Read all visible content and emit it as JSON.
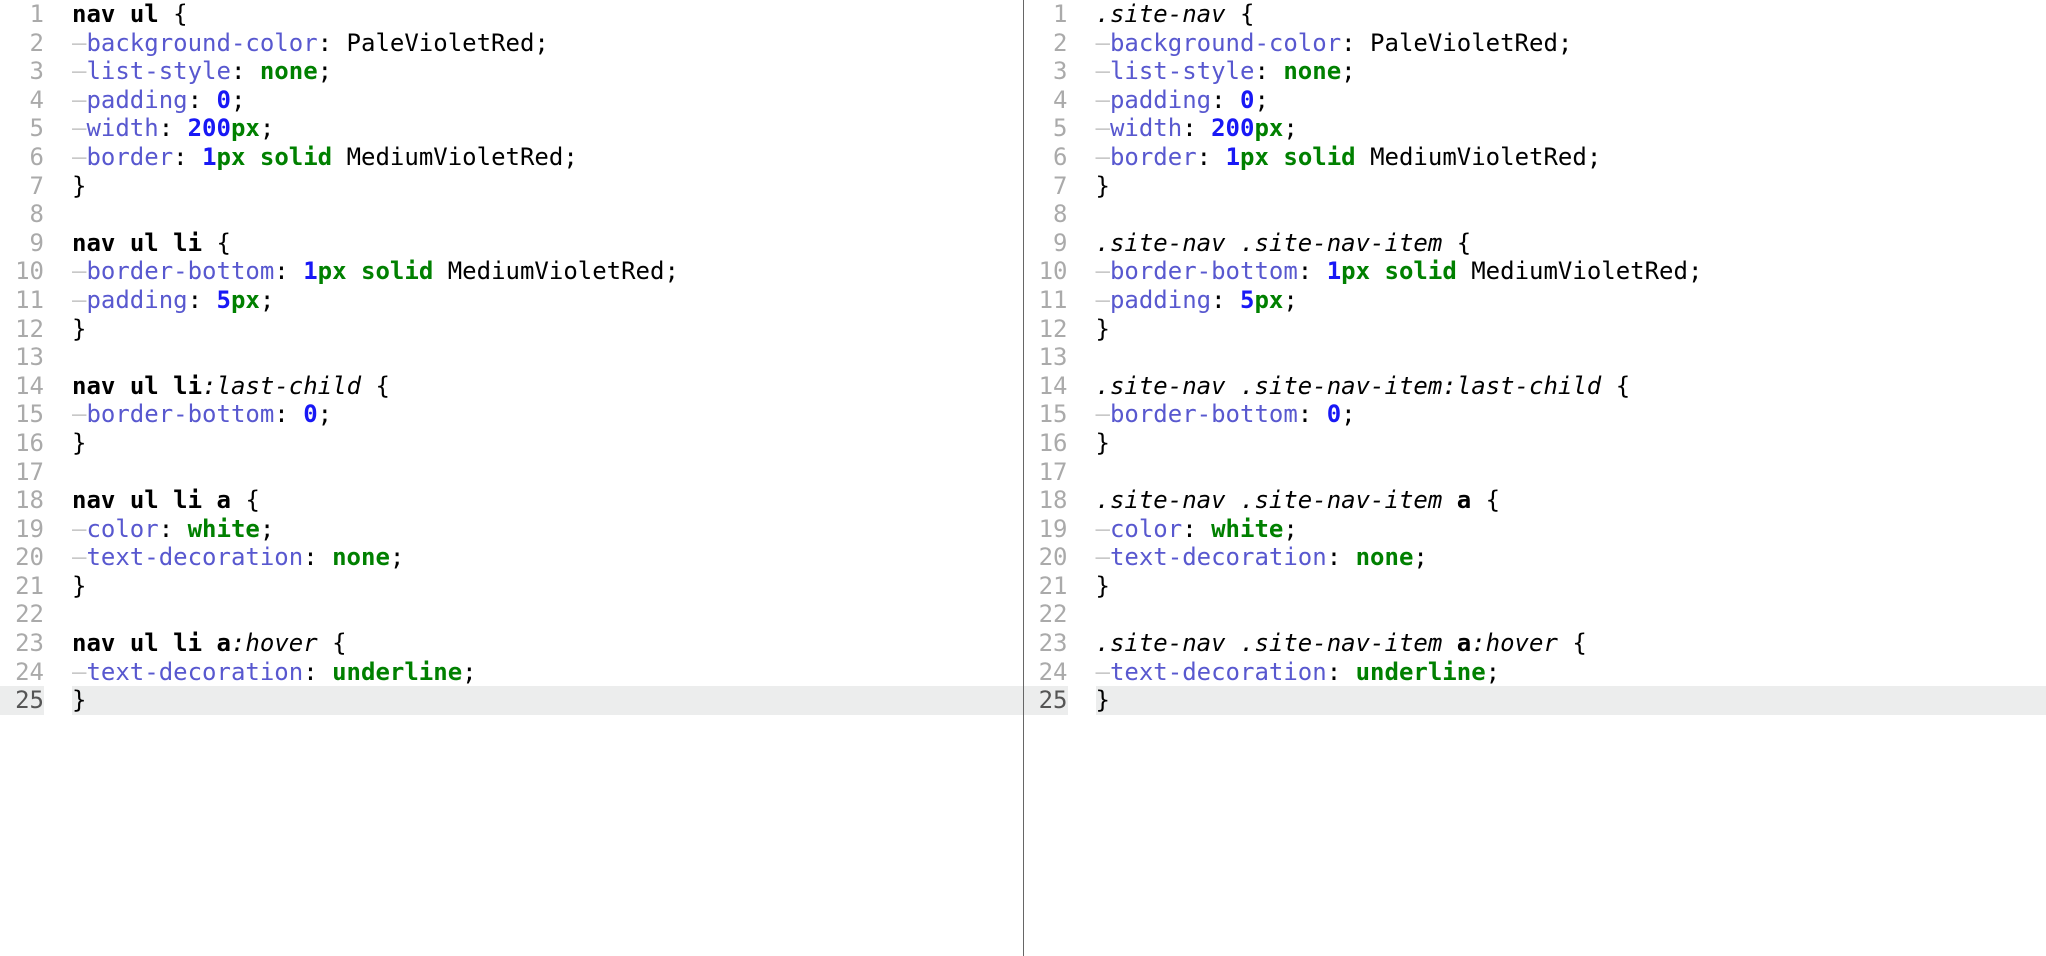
{
  "panes": [
    {
      "side": "left",
      "totalLines": 25,
      "currentLine": 25,
      "lines": [
        {
          "indent": 0,
          "tokens": [
            [
              "tag",
              "nav"
            ],
            [
              "text",
              " "
            ],
            [
              "tag",
              "ul"
            ],
            [
              "text",
              " "
            ],
            [
              "punc",
              "{"
            ]
          ]
        },
        {
          "indent": 1,
          "tokens": [
            [
              "prop",
              "background-color"
            ],
            [
              "punc",
              ":"
            ],
            [
              "text",
              " "
            ],
            [
              "plain",
              "PaleVioletRed"
            ],
            [
              "punc",
              ";"
            ]
          ]
        },
        {
          "indent": 1,
          "tokens": [
            [
              "prop",
              "list-style"
            ],
            [
              "punc",
              ":"
            ],
            [
              "text",
              " "
            ],
            [
              "kw",
              "none"
            ],
            [
              "punc",
              ";"
            ]
          ]
        },
        {
          "indent": 1,
          "tokens": [
            [
              "prop",
              "padding"
            ],
            [
              "punc",
              ":"
            ],
            [
              "text",
              " "
            ],
            [
              "num",
              "0"
            ],
            [
              "punc",
              ";"
            ]
          ]
        },
        {
          "indent": 1,
          "tokens": [
            [
              "prop",
              "width"
            ],
            [
              "punc",
              ":"
            ],
            [
              "text",
              " "
            ],
            [
              "num",
              "200"
            ],
            [
              "unit",
              "px"
            ],
            [
              "punc",
              ";"
            ]
          ]
        },
        {
          "indent": 1,
          "tokens": [
            [
              "prop",
              "border"
            ],
            [
              "punc",
              ":"
            ],
            [
              "text",
              " "
            ],
            [
              "num",
              "1"
            ],
            [
              "unit",
              "px"
            ],
            [
              "text",
              " "
            ],
            [
              "kw",
              "solid"
            ],
            [
              "text",
              " "
            ],
            [
              "plain",
              "MediumVioletRed"
            ],
            [
              "punc",
              ";"
            ]
          ]
        },
        {
          "indent": 0,
          "tokens": [
            [
              "punc",
              "}"
            ]
          ]
        },
        {
          "indent": 0,
          "tokens": []
        },
        {
          "indent": 0,
          "tokens": [
            [
              "tag",
              "nav"
            ],
            [
              "text",
              " "
            ],
            [
              "tag",
              "ul"
            ],
            [
              "text",
              " "
            ],
            [
              "tag",
              "li"
            ],
            [
              "text",
              " "
            ],
            [
              "punc",
              "{"
            ]
          ]
        },
        {
          "indent": 1,
          "tokens": [
            [
              "prop",
              "border-bottom"
            ],
            [
              "punc",
              ":"
            ],
            [
              "text",
              " "
            ],
            [
              "num",
              "1"
            ],
            [
              "unit",
              "px"
            ],
            [
              "text",
              " "
            ],
            [
              "kw",
              "solid"
            ],
            [
              "text",
              " "
            ],
            [
              "plain",
              "MediumVioletRed"
            ],
            [
              "punc",
              ";"
            ]
          ]
        },
        {
          "indent": 1,
          "tokens": [
            [
              "prop",
              "padding"
            ],
            [
              "punc",
              ":"
            ],
            [
              "text",
              " "
            ],
            [
              "num",
              "5"
            ],
            [
              "unit",
              "px"
            ],
            [
              "punc",
              ";"
            ]
          ]
        },
        {
          "indent": 0,
          "tokens": [
            [
              "punc",
              "}"
            ]
          ]
        },
        {
          "indent": 0,
          "tokens": []
        },
        {
          "indent": 0,
          "tokens": [
            [
              "tag",
              "nav"
            ],
            [
              "text",
              " "
            ],
            [
              "tag",
              "ul"
            ],
            [
              "text",
              " "
            ],
            [
              "tag",
              "li"
            ],
            [
              "pseudo",
              ":last-child"
            ],
            [
              "text",
              " "
            ],
            [
              "punc",
              "{"
            ]
          ]
        },
        {
          "indent": 1,
          "tokens": [
            [
              "prop",
              "border-bottom"
            ],
            [
              "punc",
              ":"
            ],
            [
              "text",
              " "
            ],
            [
              "num",
              "0"
            ],
            [
              "punc",
              ";"
            ]
          ]
        },
        {
          "indent": 0,
          "tokens": [
            [
              "punc",
              "}"
            ]
          ]
        },
        {
          "indent": 0,
          "tokens": []
        },
        {
          "indent": 0,
          "tokens": [
            [
              "tag",
              "nav"
            ],
            [
              "text",
              " "
            ],
            [
              "tag",
              "ul"
            ],
            [
              "text",
              " "
            ],
            [
              "tag",
              "li"
            ],
            [
              "text",
              " "
            ],
            [
              "tag",
              "a"
            ],
            [
              "text",
              " "
            ],
            [
              "punc",
              "{"
            ]
          ]
        },
        {
          "indent": 1,
          "tokens": [
            [
              "prop",
              "color"
            ],
            [
              "punc",
              ":"
            ],
            [
              "text",
              " "
            ],
            [
              "kw",
              "white"
            ],
            [
              "punc",
              ";"
            ]
          ]
        },
        {
          "indent": 1,
          "tokens": [
            [
              "prop",
              "text-decoration"
            ],
            [
              "punc",
              ":"
            ],
            [
              "text",
              " "
            ],
            [
              "kw",
              "none"
            ],
            [
              "punc",
              ";"
            ]
          ]
        },
        {
          "indent": 0,
          "tokens": [
            [
              "punc",
              "}"
            ]
          ]
        },
        {
          "indent": 0,
          "tokens": []
        },
        {
          "indent": 0,
          "tokens": [
            [
              "tag",
              "nav"
            ],
            [
              "text",
              " "
            ],
            [
              "tag",
              "ul"
            ],
            [
              "text",
              " "
            ],
            [
              "tag",
              "li"
            ],
            [
              "text",
              " "
            ],
            [
              "tag",
              "a"
            ],
            [
              "pseudo",
              ":hover"
            ],
            [
              "text",
              " "
            ],
            [
              "punc",
              "{"
            ]
          ]
        },
        {
          "indent": 1,
          "tokens": [
            [
              "prop",
              "text-decoration"
            ],
            [
              "punc",
              ":"
            ],
            [
              "text",
              " "
            ],
            [
              "kw",
              "underline"
            ],
            [
              "punc",
              ";"
            ]
          ]
        },
        {
          "indent": 0,
          "tokens": [
            [
              "punc",
              "}"
            ]
          ]
        }
      ]
    },
    {
      "side": "right",
      "totalLines": 25,
      "currentLine": 25,
      "lines": [
        {
          "indent": 0,
          "tokens": [
            [
              "class",
              ".site-nav"
            ],
            [
              "text",
              " "
            ],
            [
              "punc",
              "{"
            ]
          ]
        },
        {
          "indent": 1,
          "tokens": [
            [
              "prop",
              "background-color"
            ],
            [
              "punc",
              ":"
            ],
            [
              "text",
              " "
            ],
            [
              "plain",
              "PaleVioletRed"
            ],
            [
              "punc",
              ";"
            ]
          ]
        },
        {
          "indent": 1,
          "tokens": [
            [
              "prop",
              "list-style"
            ],
            [
              "punc",
              ":"
            ],
            [
              "text",
              " "
            ],
            [
              "kw",
              "none"
            ],
            [
              "punc",
              ";"
            ]
          ]
        },
        {
          "indent": 1,
          "tokens": [
            [
              "prop",
              "padding"
            ],
            [
              "punc",
              ":"
            ],
            [
              "text",
              " "
            ],
            [
              "num",
              "0"
            ],
            [
              "punc",
              ";"
            ]
          ]
        },
        {
          "indent": 1,
          "tokens": [
            [
              "prop",
              "width"
            ],
            [
              "punc",
              ":"
            ],
            [
              "text",
              " "
            ],
            [
              "num",
              "200"
            ],
            [
              "unit",
              "px"
            ],
            [
              "punc",
              ";"
            ]
          ]
        },
        {
          "indent": 1,
          "tokens": [
            [
              "prop",
              "border"
            ],
            [
              "punc",
              ":"
            ],
            [
              "text",
              " "
            ],
            [
              "num",
              "1"
            ],
            [
              "unit",
              "px"
            ],
            [
              "text",
              " "
            ],
            [
              "kw",
              "solid"
            ],
            [
              "text",
              " "
            ],
            [
              "plain",
              "MediumVioletRed"
            ],
            [
              "punc",
              ";"
            ]
          ]
        },
        {
          "indent": 0,
          "tokens": [
            [
              "punc",
              "}"
            ]
          ]
        },
        {
          "indent": 0,
          "tokens": []
        },
        {
          "indent": 0,
          "tokens": [
            [
              "class",
              ".site-nav"
            ],
            [
              "text",
              " "
            ],
            [
              "class",
              ".site-nav-item"
            ],
            [
              "text",
              " "
            ],
            [
              "punc",
              "{"
            ]
          ]
        },
        {
          "indent": 1,
          "tokens": [
            [
              "prop",
              "border-bottom"
            ],
            [
              "punc",
              ":"
            ],
            [
              "text",
              " "
            ],
            [
              "num",
              "1"
            ],
            [
              "unit",
              "px"
            ],
            [
              "text",
              " "
            ],
            [
              "kw",
              "solid"
            ],
            [
              "text",
              " "
            ],
            [
              "plain",
              "MediumVioletRed"
            ],
            [
              "punc",
              ";"
            ]
          ]
        },
        {
          "indent": 1,
          "tokens": [
            [
              "prop",
              "padding"
            ],
            [
              "punc",
              ":"
            ],
            [
              "text",
              " "
            ],
            [
              "num",
              "5"
            ],
            [
              "unit",
              "px"
            ],
            [
              "punc",
              ";"
            ]
          ]
        },
        {
          "indent": 0,
          "tokens": [
            [
              "punc",
              "}"
            ]
          ]
        },
        {
          "indent": 0,
          "tokens": []
        },
        {
          "indent": 0,
          "tokens": [
            [
              "class",
              ".site-nav"
            ],
            [
              "text",
              " "
            ],
            [
              "class",
              ".site-nav-item"
            ],
            [
              "pseudo",
              ":last-child"
            ],
            [
              "text",
              " "
            ],
            [
              "punc",
              "{"
            ]
          ]
        },
        {
          "indent": 1,
          "tokens": [
            [
              "prop",
              "border-bottom"
            ],
            [
              "punc",
              ":"
            ],
            [
              "text",
              " "
            ],
            [
              "num",
              "0"
            ],
            [
              "punc",
              ";"
            ]
          ]
        },
        {
          "indent": 0,
          "tokens": [
            [
              "punc",
              "}"
            ]
          ]
        },
        {
          "indent": 0,
          "tokens": []
        },
        {
          "indent": 0,
          "tokens": [
            [
              "class",
              ".site-nav"
            ],
            [
              "text",
              " "
            ],
            [
              "class",
              ".site-nav-item"
            ],
            [
              "text",
              " "
            ],
            [
              "tag",
              "a"
            ],
            [
              "text",
              " "
            ],
            [
              "punc",
              "{"
            ]
          ]
        },
        {
          "indent": 1,
          "tokens": [
            [
              "prop",
              "color"
            ],
            [
              "punc",
              ":"
            ],
            [
              "text",
              " "
            ],
            [
              "kw",
              "white"
            ],
            [
              "punc",
              ";"
            ]
          ]
        },
        {
          "indent": 1,
          "tokens": [
            [
              "prop",
              "text-decoration"
            ],
            [
              "punc",
              ":"
            ],
            [
              "text",
              " "
            ],
            [
              "kw",
              "none"
            ],
            [
              "punc",
              ";"
            ]
          ]
        },
        {
          "indent": 0,
          "tokens": [
            [
              "punc",
              "}"
            ]
          ]
        },
        {
          "indent": 0,
          "tokens": []
        },
        {
          "indent": 0,
          "tokens": [
            [
              "class",
              ".site-nav"
            ],
            [
              "text",
              " "
            ],
            [
              "class",
              ".site-nav-item"
            ],
            [
              "text",
              " "
            ],
            [
              "tag",
              "a"
            ],
            [
              "pseudo",
              ":hover"
            ],
            [
              "text",
              " "
            ],
            [
              "punc",
              "{"
            ]
          ]
        },
        {
          "indent": 1,
          "tokens": [
            [
              "prop",
              "text-decoration"
            ],
            [
              "punc",
              ":"
            ],
            [
              "text",
              " "
            ],
            [
              "kw",
              "underline"
            ],
            [
              "punc",
              ";"
            ]
          ]
        },
        {
          "indent": 0,
          "tokens": [
            [
              "punc",
              "}"
            ]
          ]
        }
      ]
    }
  ]
}
